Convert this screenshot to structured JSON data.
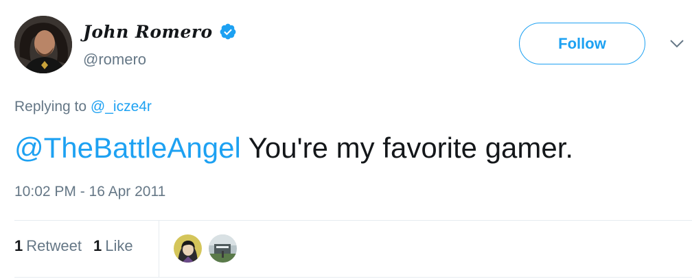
{
  "user": {
    "display_name": "John Romero",
    "handle": "@romero",
    "verified": true
  },
  "header": {
    "follow_label": "Follow",
    "more_icon": "chevron-down-icon"
  },
  "reply": {
    "prefix": "Replying to",
    "to_handle": "@_icze4r"
  },
  "tweet": {
    "mention": "@TheBattleAngel",
    "text": " You're my favorite gamer.",
    "timestamp": "10:02 PM - 16 Apr 2011"
  },
  "stats": {
    "retweet_count": "1",
    "retweet_label": "Retweet",
    "like_count": "1",
    "like_label": "Like"
  },
  "colors": {
    "accent": "#1da1f2",
    "text_primary": "#14171a",
    "text_secondary": "#657786",
    "divider": "#e6ecf0"
  }
}
